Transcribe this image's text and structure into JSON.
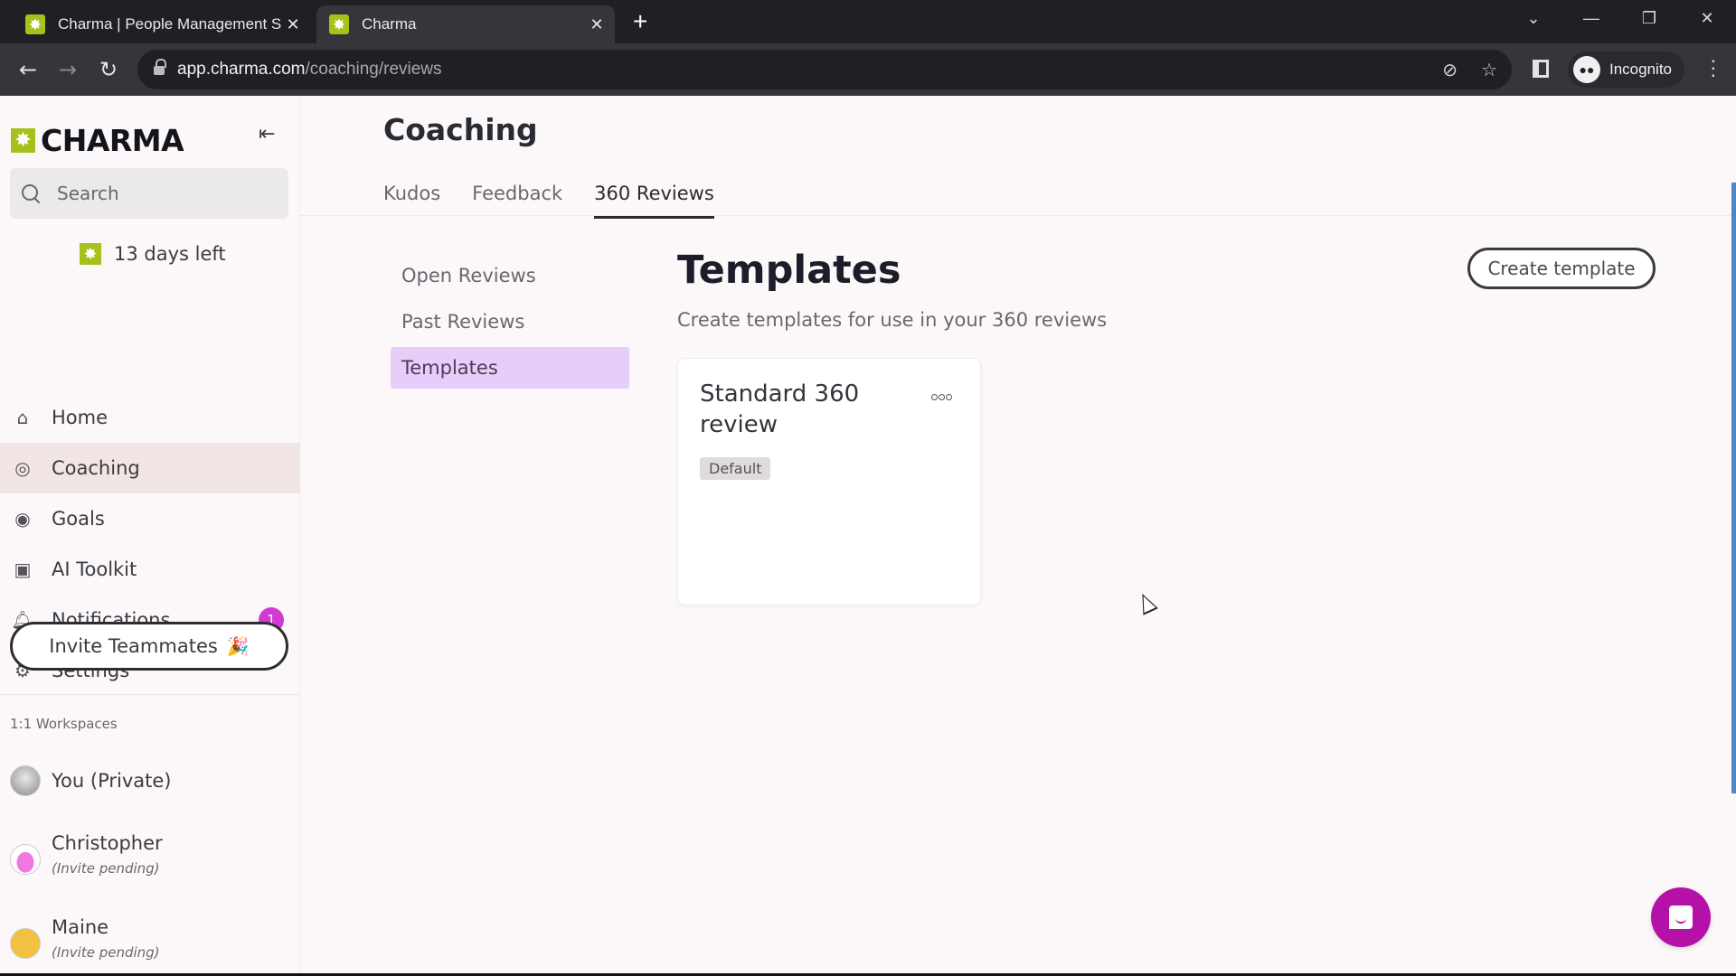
{
  "browser": {
    "tabs": [
      {
        "title": "Charma | People Management S",
        "active": false
      },
      {
        "title": "Charma",
        "active": true
      }
    ],
    "new_tab_label": "+",
    "url_host": "app.charma.com",
    "url_path": "/coaching/reviews",
    "profile_label": "Incognito",
    "window_controls": {
      "dropdown": "⌄",
      "minimize": "—",
      "restore": "❐",
      "close": "✕"
    }
  },
  "sidebar": {
    "logo_text": "CHARMA",
    "collapse_icon": "⇤",
    "search_placeholder": "Search",
    "trial_text": "13 days left",
    "nav": [
      {
        "label": "Home",
        "icon": "home-icon",
        "glyph": "⌂",
        "active": false
      },
      {
        "label": "Coaching",
        "icon": "whistle-icon",
        "glyph": "◎",
        "active": true
      },
      {
        "label": "Goals",
        "icon": "target-icon",
        "glyph": "◉",
        "active": false
      },
      {
        "label": "AI Toolkit",
        "icon": "robot-icon",
        "glyph": "▣",
        "active": false
      },
      {
        "label": "Notifications",
        "icon": "bell-icon",
        "glyph": "🔔︎",
        "active": false,
        "badge": "1"
      },
      {
        "label": "Settings",
        "icon": "gear-icon",
        "glyph": "⚙",
        "active": false
      }
    ],
    "invite_label": "Invite Teammates",
    "invite_emoji": "🎉",
    "workspaces_label": "1:1 Workspaces",
    "workspaces": [
      {
        "name": "You (Private)",
        "status": ""
      },
      {
        "name": "Christopher",
        "status": "(Invite pending)"
      },
      {
        "name": "Maine",
        "status": "(Invite pending)"
      }
    ]
  },
  "main": {
    "page_title": "Coaching",
    "tabs": [
      {
        "label": "Kudos",
        "active": false
      },
      {
        "label": "Feedback",
        "active": false
      },
      {
        "label": "360 Reviews",
        "active": true
      }
    ],
    "subnav": [
      {
        "label": "Open Reviews",
        "active": false
      },
      {
        "label": "Past Reviews",
        "active": false
      },
      {
        "label": "Templates",
        "active": true
      }
    ],
    "content_title": "Templates",
    "content_subtitle": "Create templates for use in your 360 reviews",
    "create_button": "Create template",
    "templates": [
      {
        "title": "Standard 360 review",
        "badge": "Default"
      }
    ]
  },
  "colors": {
    "brand": "#a6c11c",
    "active_nav_bg": "#f2e6e4",
    "active_subnav_bg": "#e8ccfa",
    "notification_badge": "#d33ad3",
    "chat_fab": "#b511a8",
    "scrollbar": "#4a86c8"
  }
}
